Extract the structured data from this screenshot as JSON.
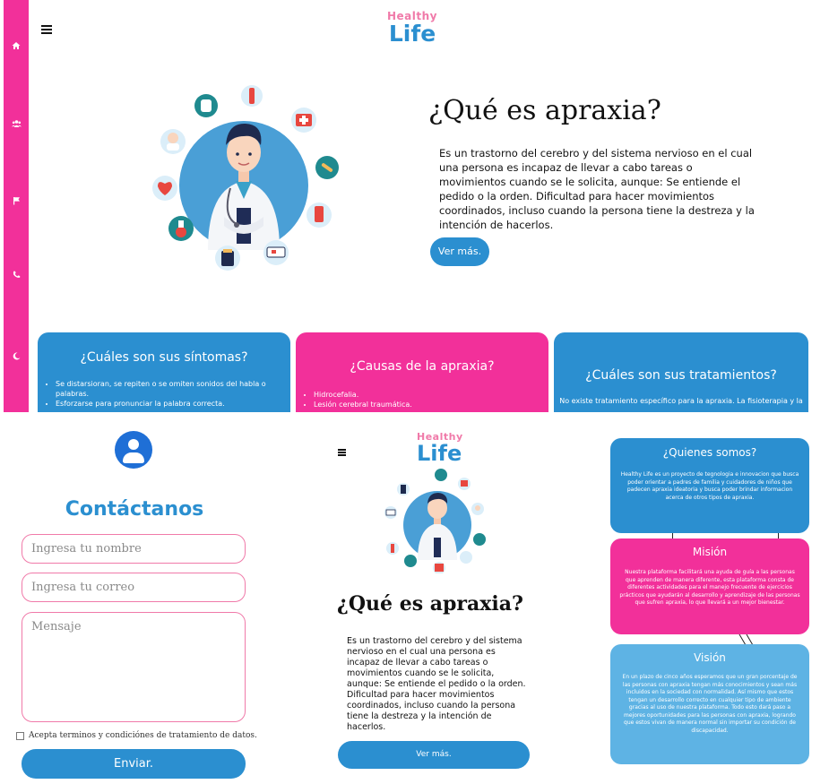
{
  "brand": {
    "line1": "Healthy",
    "line2": "Life"
  },
  "colors": {
    "pink": "#f2309a",
    "blue": "#2b8fd0",
    "light_blue": "#5eb3e4",
    "avatar_blue": "#1f6fd6"
  },
  "sidebar": {
    "icons": [
      "home-icon",
      "users-icon",
      "flag-icon",
      "phone-icon",
      "moon-icon"
    ]
  },
  "hero": {
    "title": "¿Qué es apraxia?",
    "text": "Es un trastorno del cerebro y del sistema nervioso en el cual una persona es incapaz de llevar a cabo tareas o movimientos cuando se le solicita, aunque: Se entiende el pedido o la orden. Dificultad para hacer movimientos coordinados, incluso cuando la persona tiene la destreza y la intención de hacerlos.",
    "button": "Ver más."
  },
  "cards": {
    "symptoms": {
      "title": "¿Cuáles son sus síntomas?",
      "items": [
        "Se distarsioran, se repiten o se omiten sonidos del habla o palabras.",
        "Esforzarse para pronunciar la palabra correcta."
      ]
    },
    "causes": {
      "title": "¿Causas de la apraxia?",
      "items": [
        "Hidrocefalia.",
        "Lesión cerebral traumática."
      ]
    },
    "treatments": {
      "title": "¿Cuáles son sus tratamientos?",
      "text": "No existe tratamiento específico para la apraxia. La fisioterapia y la"
    }
  },
  "contact": {
    "title": "Contáctanos",
    "name_placeholder": "Ingresa tu nombre",
    "email_placeholder": "Ingresa tu correo",
    "message_placeholder": "Mensaje",
    "terms": "Acepta terminos y condiciónes de tratamiento de datos.",
    "submit": "Enviar."
  },
  "mobile": {
    "title": "¿Qué es apraxia?",
    "text": "Es un trastorno del cerebro y del sistema nervioso en el cual una persona es incapaz de llevar a cabo tareas o movimientos cuando se le solicita, aunque: Se entiende el pedido o la orden. Dificultad para hacer movimientos coordinados, incluso cuando la persona tiene la destreza y la intención de hacerlos.",
    "button": "Ver más."
  },
  "about": {
    "who": {
      "title": "¿Quienes somos?",
      "text": "Healthy Life es un proyecto de tegnologia e innovacion que busca poder orientar a padres de familia y cuidadores de niños que padecen apraxia ideatoria y busca poder brindar informacion acerca de otros tipos de apraxia."
    },
    "mission": {
      "title": "Misión",
      "text": "Nuestra plataforma facilitará una ayuda de guía a las personas que aprenden de manera diferente, esta plataforma consta de diferentes actividades para el manejo frecuente de ejercicios prácticos que ayudarán al desarrollo y aprendizaje de las personas que sufren apraxia, lo que llevará a un mejor bienestar."
    },
    "vision": {
      "title": "Visión",
      "text": "En un plazo de cinco años esperamos que un gran porcentaje de las personas con apraxia tengan más conocimientos y sean más incluidos en la sociedad con normalidad. Así mismo que estos tengan un desarrollo correcto en cualquier tipo de ambiente gracias al uso de nuestra plataforma. Todo esto dará paso a mejores oportunidades para las personas con apraxia, logrando que estos vivan de manera normal sin importar su condición de discapacidad."
    }
  }
}
